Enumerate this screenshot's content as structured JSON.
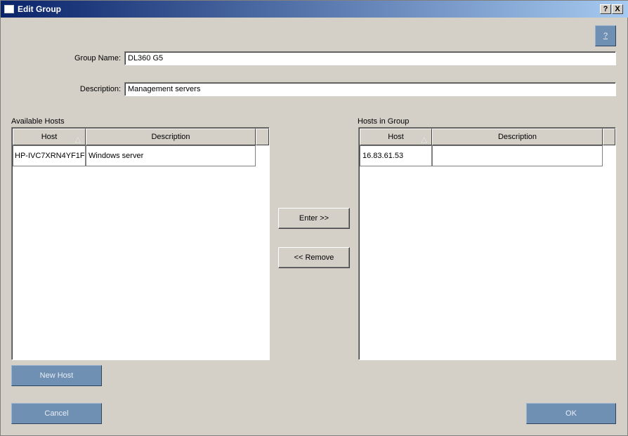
{
  "window": {
    "title": "Edit Group",
    "help_label": "?",
    "close_label": "X"
  },
  "help_button": {
    "label": "?"
  },
  "form": {
    "group_name_label": "Group Name:",
    "group_name_value": "DL360 G5",
    "description_label": "Description:",
    "description_value": "Management servers"
  },
  "available": {
    "title": "Available Hosts",
    "columns": [
      "Host",
      "Description"
    ],
    "rows": [
      {
        "host": "HP-IVC7XRN4YF1F",
        "description": "Windows server"
      }
    ]
  },
  "ingroup": {
    "title": "Hosts in Group",
    "columns": [
      "Host",
      "Description"
    ],
    "rows": [
      {
        "host": "16.83.61.53",
        "description": ""
      }
    ]
  },
  "buttons": {
    "enter": "Enter >>",
    "remove": "<< Remove",
    "new_host": "New Host",
    "cancel": "Cancel",
    "ok": "OK"
  }
}
